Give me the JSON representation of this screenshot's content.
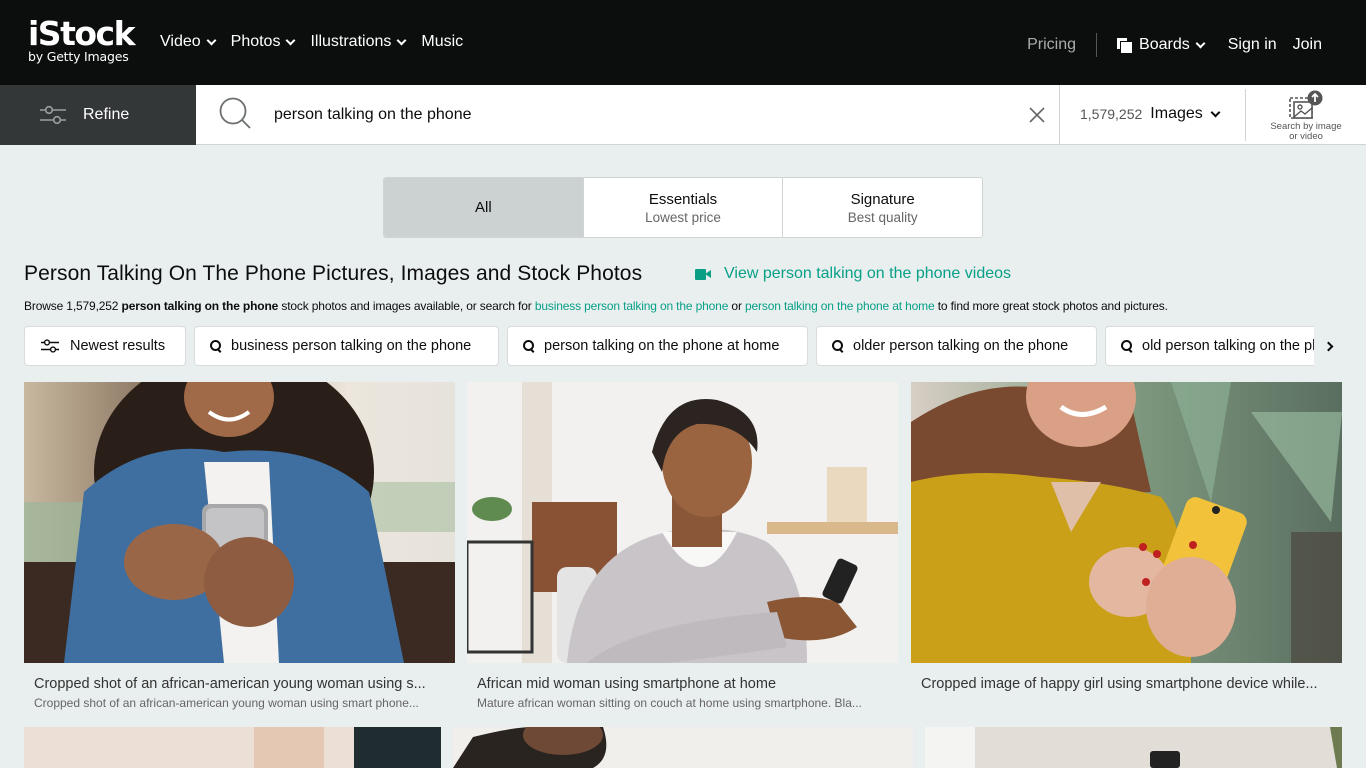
{
  "header": {
    "logo": {
      "brand": "iStock",
      "sub": "by Getty Images"
    },
    "nav": [
      {
        "label": "Video",
        "dropdown": true
      },
      {
        "label": "Photos",
        "dropdown": true
      },
      {
        "label": "Illustrations",
        "dropdown": true
      },
      {
        "label": "Music",
        "dropdown": false
      }
    ],
    "pricing": "Pricing",
    "boards": "Boards",
    "sign_in": "Sign in",
    "join": "Join"
  },
  "search": {
    "refine_label": "Refine",
    "query": "person talking on the phone",
    "result_count": "1,579,252",
    "media_type": "Images",
    "search_by_image_line1": "Search by image",
    "search_by_image_line2": "or video"
  },
  "segments": [
    {
      "title": "All",
      "subtitle": "",
      "active": true
    },
    {
      "title": "Essentials",
      "subtitle": "Lowest price",
      "active": false
    },
    {
      "title": "Signature",
      "subtitle": "Best quality",
      "active": false
    }
  ],
  "heading": {
    "title": "Person Talking On The Phone Pictures, Images and Stock Photos",
    "video_link": "View person talking on the phone videos",
    "browse": {
      "prefix": "Browse 1,579,252 ",
      "bold": "person talking on the phone",
      "middle": " stock photos and images available, or search for ",
      "link1": "business person talking on the phone",
      "or": " or ",
      "link2": "person talking on the phone at home",
      "suffix": " to find more great stock photos and pictures."
    }
  },
  "chips": [
    {
      "label": "Newest results",
      "icon": "sliders-icon"
    },
    {
      "label": "business person talking on the phone",
      "icon": "search-icon"
    },
    {
      "label": "person talking on the phone at home",
      "icon": "search-icon"
    },
    {
      "label": "older person talking on the phone",
      "icon": "search-icon"
    },
    {
      "label": "old person talking on the phone",
      "icon": "search-icon"
    }
  ],
  "results": [
    {
      "title": "Cropped shot of an african-american young woman using s...",
      "description": "Cropped shot of an african-american young woman using smart phone..."
    },
    {
      "title": "African mid woman using smartphone at home",
      "description": "Mature african woman sitting on couch at home using smartphone. Bla..."
    },
    {
      "title": "Cropped image of happy girl using smartphone device while...",
      "description": ""
    }
  ],
  "colors": {
    "header_bg": "#0c0d0d",
    "refine_bg": "#333737",
    "page_bg": "#e9eeee",
    "accent_link": "#08a088",
    "active_segment": "#ccd2d2"
  }
}
